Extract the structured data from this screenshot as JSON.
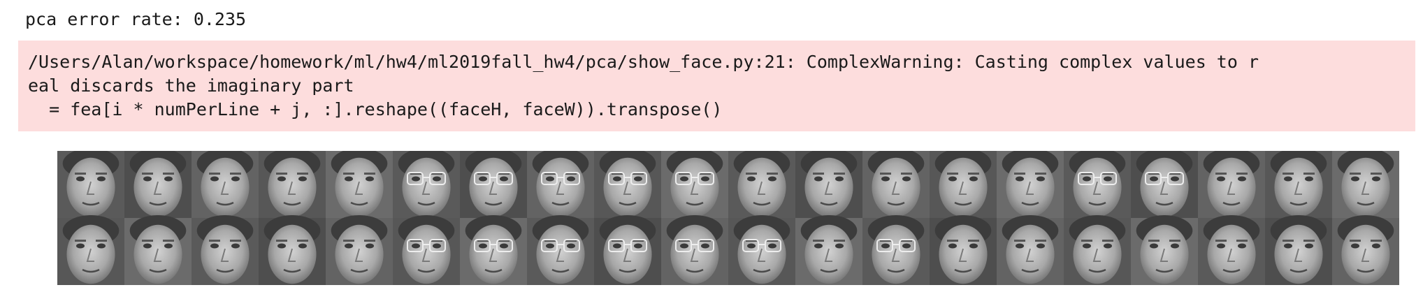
{
  "output": {
    "stdout_line": "pca error rate: 0.235",
    "stderr_lines": [
      "/Users/Alan/workspace/homework/ml/hw4/ml2019fall_hw4/pca/show_face.py:21: ComplexWarning: Casting complex values to r",
      "eal discards the imaginary part",
      "  = fea[i * numPerLine + j, :].reshape((faceH, faceW)).transpose()"
    ],
    "stderr_background": "#fddddd"
  },
  "face_grid": {
    "rows": 2,
    "cols": 20,
    "colorscale": "grayscale",
    "glasses_top_row": [
      5,
      6,
      7,
      8,
      9,
      15,
      16
    ],
    "glasses_bottom_row": [
      5,
      6,
      7,
      8,
      9,
      10,
      12
    ]
  }
}
